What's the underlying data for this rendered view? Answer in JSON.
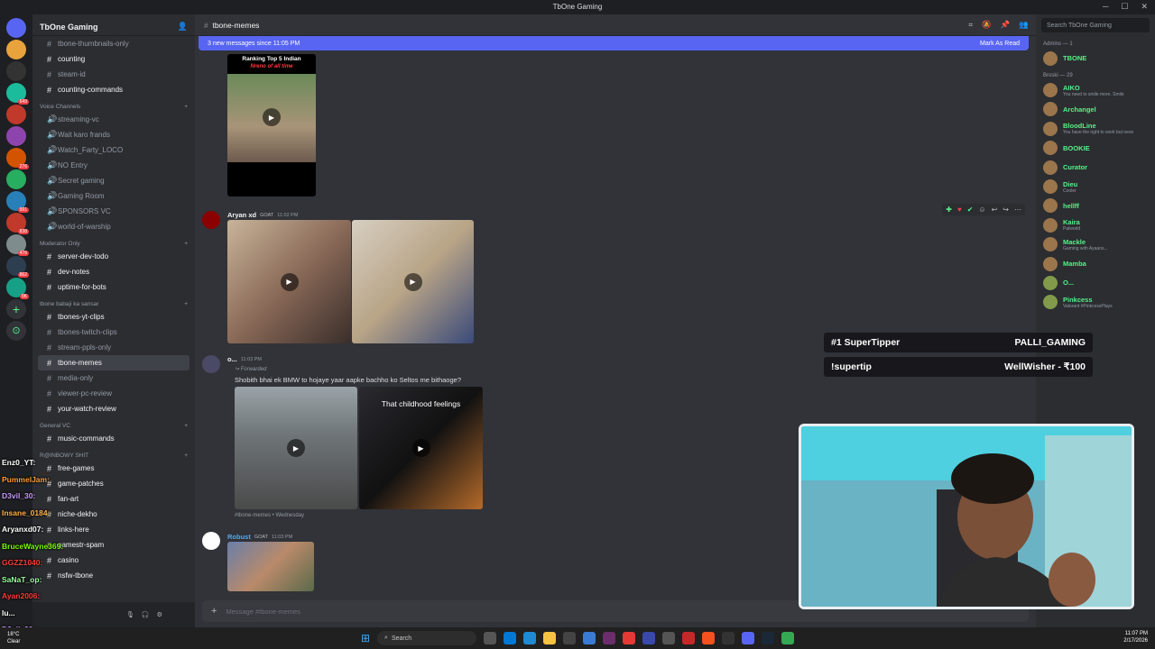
{
  "window": {
    "title": "TbOne Gaming"
  },
  "server": {
    "name": "TbOne Gaming"
  },
  "channels": {
    "top": [
      {
        "name": "tbone-thumbnails-only",
        "state": "muted"
      },
      {
        "name": "counting",
        "state": "unread"
      },
      {
        "name": "steam-id",
        "state": "muted"
      },
      {
        "name": "counting-commands",
        "state": "unread"
      }
    ],
    "voice_category": "Voice Channels",
    "voice": [
      "streaming-vc",
      "Wait karo frands",
      "Watch_Farty_LOCO",
      "NO Entry",
      "Secret gaming",
      "Gaming Room",
      "SPONSORS VC",
      "world-of-warship"
    ],
    "mod_category": "Moderator Only",
    "mod": [
      "server-dev-todo",
      "dev-notes",
      "uptime-for-bots"
    ],
    "sansar_category": "tbone babaji ka sansar",
    "sansar": [
      {
        "name": "tbones-yt-clips",
        "state": "unread"
      },
      {
        "name": "tbones-twitch-clips",
        "state": "muted"
      },
      {
        "name": "stream-ppls-only",
        "state": "muted"
      },
      {
        "name": "tbone-memes",
        "state": "active"
      },
      {
        "name": "media-only",
        "state": "muted"
      },
      {
        "name": "viewer-pc-review",
        "state": "muted"
      },
      {
        "name": "your-watch-review",
        "state": "unread"
      }
    ],
    "general_category": "General VC",
    "general": [
      {
        "name": "music-commands",
        "state": "unread"
      }
    ],
    "rainbow_category": "R@INBOWY SHIT",
    "rainbow": [
      "free-games",
      "game-patches",
      "fan-art",
      "niche-dekho",
      "links-here",
      "gamestr-spam",
      "casino",
      "nsfw-tbone"
    ]
  },
  "stream_chat": [
    {
      "name": "Enz0_YT:",
      "color": "#ffffff"
    },
    {
      "name": "PummelJam:",
      "color": "#ff9a3c"
    },
    {
      "name": "D3vil_30:",
      "color": "#c89bff"
    },
    {
      "name": "Insane_0184:",
      "color": "#ffb347"
    },
    {
      "name": "Aryanxd07:",
      "color": "#ffffff"
    },
    {
      "name": "BruceWayne369:",
      "color": "#7cfc00"
    },
    {
      "name": "GGZZ1040:",
      "color": "#ff3b3b"
    },
    {
      "name": "SaNaT_op:",
      "color": "#9bff9b"
    },
    {
      "name": "Ayan2006:",
      "color": "#ff3b3b"
    },
    {
      "name": "lu...",
      "color": "#ffffff"
    },
    {
      "name": "D3vil_30:",
      "color": "#c89bff"
    }
  ],
  "channel_header": {
    "name": "tbone-memes"
  },
  "new_messages": {
    "text": "3 new messages since 11:05 PM",
    "action": "Mark As Read"
  },
  "messages": [
    {
      "poster_title": "Ranking Top 5 Indian",
      "poster_subtitle": "Nreno of all time"
    },
    {
      "author": "Aryan xd",
      "tag": "GOAT",
      "time": "11:02 PM"
    },
    {
      "author": "o...",
      "time": "11:03 PM",
      "forwarded": "Forwarded",
      "text": "Shobith bhai ek BMW to hojaye yaar aapke bachho ko Seltos me bithaoge?",
      "overlay": "That childhood feelings",
      "footer": "#tbone-memes • Wednesday"
    },
    {
      "author": "Robust",
      "tag": "GOAT",
      "time": "11:03 PM"
    }
  ],
  "composer": {
    "placeholder": "Message #tbone-memes"
  },
  "members": {
    "search_placeholder": "Search TbOne Gaming",
    "admins_label": "Admins — 1",
    "admins": [
      {
        "name": "TBONE",
        "color": "#57f287",
        "status": ""
      }
    ],
    "broski_label": "Broski — 29",
    "broski": [
      {
        "name": "AIKO",
        "color": "#57f287",
        "status": "You need to smile more. Smile",
        "tag": "sqcL"
      },
      {
        "name": "Archangel",
        "color": "#57f287",
        "status": ""
      },
      {
        "name": "BloodLine",
        "color": "#57f287",
        "status": "You have the right to work but neve"
      },
      {
        "name": "BOOKIE",
        "color": "#57f287",
        "status": "",
        "tag": "ROZA"
      },
      {
        "name": "Curator",
        "color": "#57f287",
        "status": "",
        "tag": "GOAT"
      },
      {
        "name": "Dieu",
        "color": "#57f287",
        "status": "Cooler"
      },
      {
        "name": "hellff",
        "color": "#57f287",
        "status": ""
      },
      {
        "name": "Kaira",
        "color": "#57f287",
        "status": "Palworld",
        "tag": "WWM"
      },
      {
        "name": "Mackle",
        "color": "#57f287",
        "status": "Gaming with Ayaans..."
      },
      {
        "name": "Mamba",
        "color": "#57f287",
        "status": ""
      },
      {
        "name": "O...",
        "color": "#57f287",
        "status": ""
      },
      {
        "name": "Pinkcess",
        "color": "#57f287",
        "status": "Valorant #PinkcessPlays"
      }
    ]
  },
  "alerts": [
    {
      "label": "#1 SuperTipper",
      "value": "PALLI_GAMING"
    },
    {
      "label": "!supertip",
      "value": "WellWisher - ₹100"
    }
  ],
  "taskbar": {
    "search": "Search",
    "weather_temp": "18°C",
    "weather_desc": "Clear",
    "time": "11:07 PM",
    "date": "2/17/2026"
  }
}
